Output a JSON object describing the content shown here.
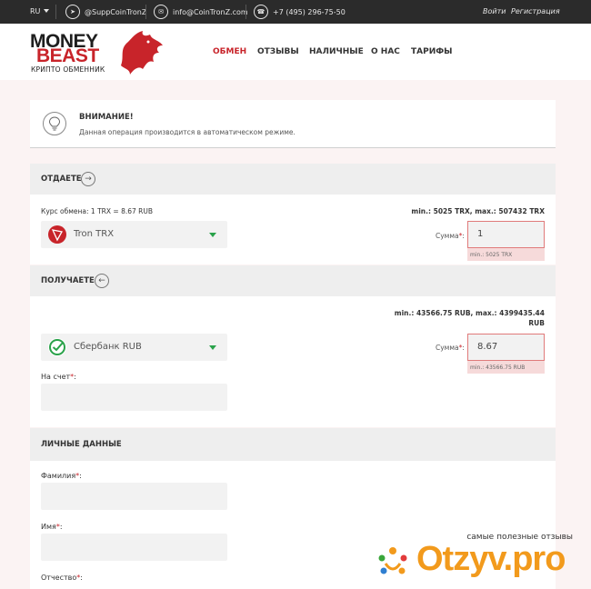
{
  "topbar": {
    "lang": "RU",
    "telegram": "@SuppCoinTronZ",
    "email": "info@CoinTronZ.com",
    "phone": "+7 (495) 296-75-50",
    "login": "Войти",
    "register": "Регистрация"
  },
  "logo": {
    "line1": "MONEY",
    "line2": "BEAST",
    "sub": "КРИПТО ОБМЕННИК"
  },
  "nav": [
    "ОБМЕН",
    "ОТЗЫВЫ",
    "НАЛИЧНЫЕ",
    "О НАС",
    "ТАРИФЫ"
  ],
  "alert": {
    "title": "ВНИМАНИЕ!",
    "text": "Данная операция производится в автоматическом режиме."
  },
  "give": {
    "title": "ОТДАЕТЕ",
    "rate": "Курс обмена: 1 TRX = 8.67 RUB",
    "limits": "min.: 5025 TRX, max.: 507432 TRX",
    "currency": "Tron TRX",
    "sum_label": "Сумма",
    "sum_value": "1",
    "sum_error": "min.: 5025 TRX"
  },
  "receive": {
    "title": "ПОЛУЧАЕТЕ",
    "limits_line1": "min.: 43566.75 RUB, max.: 4399435.44",
    "limits_line2": "RUB",
    "currency": "Сбербанк RUB",
    "sum_label": "Сумма",
    "sum_value": "8.67",
    "sum_error": "min.: 43566.75 RUB",
    "account_label": "На счет"
  },
  "personal": {
    "title": "ЛИЧНЫЕ ДАННЫЕ",
    "surname_label": "Фамилия",
    "name_label": "Имя",
    "patronymic_label": "Отчество"
  },
  "watermark": {
    "caption": "самые полезные отзывы",
    "brand": "Otzyv.pro"
  },
  "colors": {
    "accent": "#c8242a",
    "topbar": "#2b2b2b",
    "error_border": "#e07a7a",
    "sber_green": "#2aa24a"
  }
}
